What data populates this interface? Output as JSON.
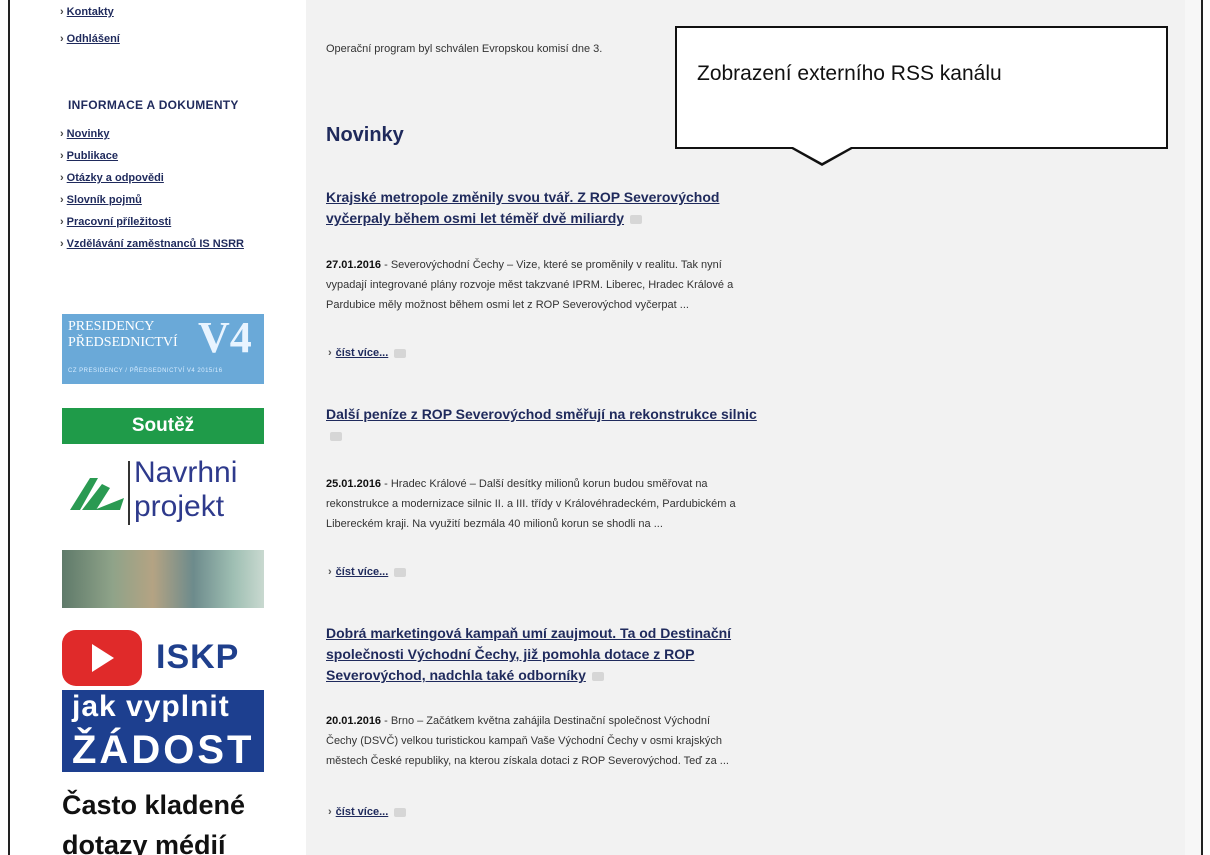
{
  "sidebar": {
    "top_links": [
      "Kontakty",
      "Odhlášení"
    ],
    "section_heading": "INFORMACE A DOKUMENTY",
    "links": [
      "Novinky",
      "Publikace",
      "Otázky a odpovědi",
      "Slovník pojmů",
      "Pracovní příležitosti",
      "Vzdělávání zaměstnanců IS NSRR"
    ],
    "banners": {
      "v4": {
        "line1": "PRESIDENCY",
        "line2": "PŘEDSEDNICTVÍ",
        "mark": "V4",
        "sub": "CZ PRESIDENCY / PŘEDSEDNICTVÍ V4 2015/16"
      },
      "soutez": "Soutěž",
      "navrhni": {
        "line1": "Navrhni",
        "line2": "projekt"
      },
      "iskp": "ISKP",
      "zadost": {
        "line1": "jak vyplnit",
        "line2": "ŽÁDOST"
      },
      "faq": {
        "line1": "Často kladené",
        "line2": "dotazy médií"
      }
    }
  },
  "main": {
    "intro": "Operační program byl schválen Evropskou komisí dne 3.",
    "section_title": "Novinky",
    "read_more_label": "číst více...",
    "articles": [
      {
        "title_line1": "Krajské metropole změnily svou tvář. Z ROP Severovýchod",
        "title_line2": "vyčerpaly během osmi let téměř dvě miliardy",
        "date": "27.01.2016",
        "body_line1": " - Severovýchodní Čechy – Vize, které se proměnily v realitu. Tak nyní",
        "body_line2": "vypadají integrované plány rozvoje měst takzvané IPRM. Liberec, Hradec Králové a",
        "body_line3": "Pardubice měly možnost během osmi let z ROP Severovýchod vyčerpat ..."
      },
      {
        "title_line1": "Další peníze z ROP Severovýchod směřují na rekonstrukce silnic",
        "date": "25.01.2016",
        "body_line1": " - Hradec Králové – Další desítky milionů korun budou směřovat na",
        "body_line2": "rekonstrukce a modernizace silnic II. a III. třídy v Královéhradeckém, Pardubickém a",
        "body_line3": "Libereckém kraji. Na využití bezmála 40 milionů korun se shodli na ..."
      },
      {
        "title_line1": "Dobrá marketingová kampaň umí zaujmout. Ta od Destinační",
        "title_line2": "společnosti Východní Čechy, již pomohla dotace z ROP",
        "title_line3": "Severovýchod, nadchla také odborníky",
        "date": "20.01.2016",
        "body_line1": " - Brno – Začátkem května zahájila Destinační společnost Východní",
        "body_line2": "Čechy (DSVČ) velkou turistickou kampaň Vaše Východní Čechy v osmi krajských",
        "body_line3": "městech České republiky, na kterou získala dotaci z ROP Severovýchod. Teď za ..."
      }
    ]
  },
  "callout": {
    "text": "Zobrazení externího RSS kanálu"
  }
}
